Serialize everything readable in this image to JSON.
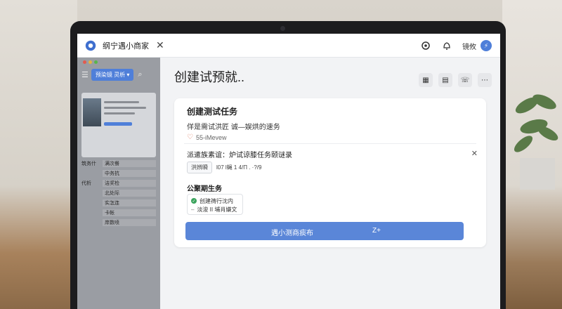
{
  "window": {
    "app_title": "纲宁遇小商家",
    "close_label": "✕"
  },
  "header": {
    "user_label": "镜攸",
    "user_initial": "⚡"
  },
  "icons": {
    "app": "gear-icon",
    "settings": "settings-icon",
    "bell": "bell-icon",
    "grid": "grid-icon",
    "clipboard": "clipboard-icon",
    "phone": "phone-icon",
    "more": "more-icon"
  },
  "sidebar": {
    "chip_label": "预染镜 灵析 ▾",
    "items": [
      {
        "key": "筑务什",
        "value": "满次餐"
      },
      {
        "key": "",
        "value": "中务抗"
      },
      {
        "key": "代析",
        "value": "洁奖检"
      },
      {
        "key": "",
        "value": "北处际"
      },
      {
        "key": "",
        "value": "实怎连"
      },
      {
        "key": "",
        "value": "卡帐"
      },
      {
        "key": "",
        "value": "岸数喷"
      }
    ]
  },
  "main": {
    "page_title": "创建试预就..",
    "card": {
      "title": "创建测试任务",
      "subtitle": "佯是需试洪匠  诚—娱烘的速务",
      "link_text": "55-iMevew",
      "requirement": "派遣族素谊：炉试谅膝任务颐谜录",
      "tag_label": "洪辨瞬",
      "tag_meta": "l07 l蝇 1 4/Π .  ·?/9",
      "section_title": "公聚期生务",
      "selected_primary": "创建祷行沈内",
      "selected_secondary": "淡浚 II 埔肖嫌文",
      "button_label": "遇小测商痰布",
      "button_shortcut": "Z+"
    }
  },
  "colors": {
    "accent": "#5a86d8",
    "sidebar": "#9a9da3",
    "success": "#3aa35c"
  }
}
